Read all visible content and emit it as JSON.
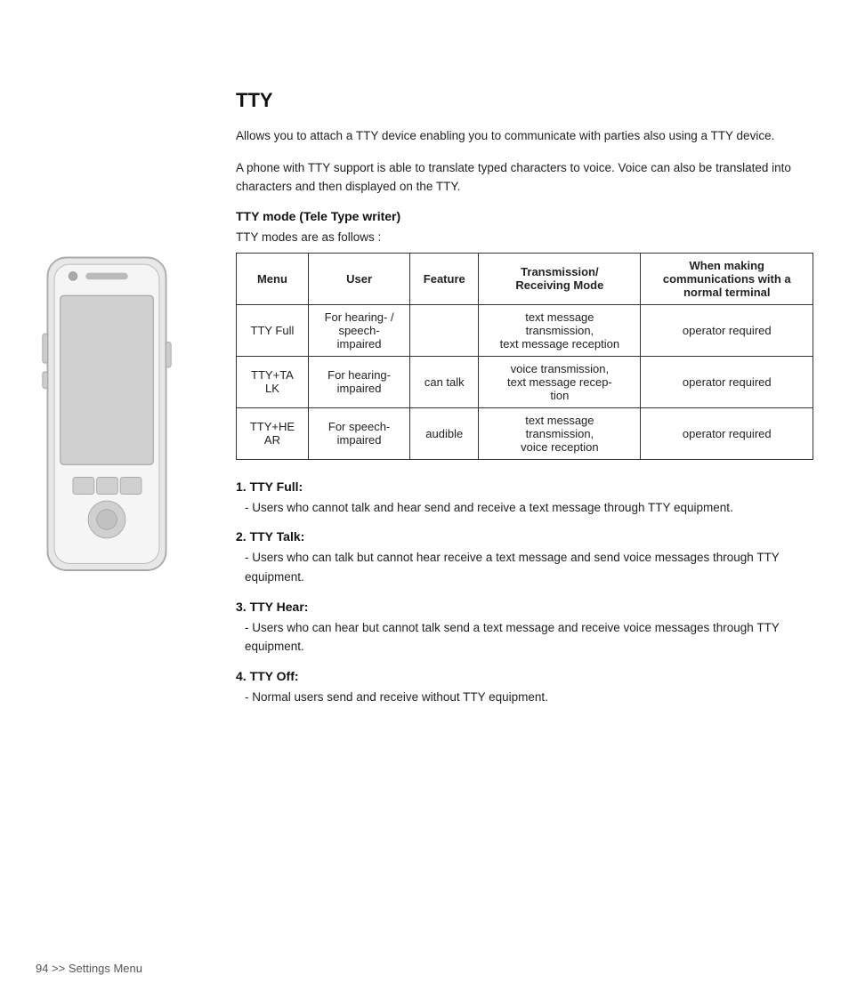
{
  "page": {
    "title": "TTY",
    "intro1": "Allows you to attach a TTY device enabling you to communicate with parties also using a TTY device.",
    "intro2": "A phone with TTY support is able to translate typed characters to voice. Voice can also be translated into characters and then displayed on the TTY.",
    "section_heading": "TTY mode (Tele Type writer)",
    "modes_intro": "TTY modes are as follows :",
    "table": {
      "headers": [
        "Menu",
        "User",
        "Feature",
        "Transmission/\nReceiving Mode",
        "When making\ncommunications with a\nnormal terminal"
      ],
      "rows": [
        {
          "menu": "TTY Full",
          "user": "For hearing- / speech-impaired",
          "feature": "",
          "transmission": "text message transmission, text message reception",
          "when": "operator required"
        },
        {
          "menu": "TTY+TALK",
          "user": "For hearing-impaired",
          "feature": "can talk",
          "transmission": "voice transmission, text message reception",
          "when": "operator required"
        },
        {
          "menu": "TTY+HEAR",
          "user": "For speech-impaired",
          "feature": "audible",
          "transmission": "text message transmission, voice reception",
          "when": "operator required"
        }
      ]
    },
    "sections": [
      {
        "heading": "1. TTY Full:",
        "text": "- Users who cannot talk and hear send and receive a text message through TTY equipment."
      },
      {
        "heading": "2. TTY Talk:",
        "text": "- Users who can talk but cannot hear receive a text message and send voice messages through TTY equipment."
      },
      {
        "heading": "3. TTY Hear:",
        "text": "- Users who can hear but cannot talk send a text message and receive voice messages through TTY equipment."
      },
      {
        "heading": "4. TTY Off:",
        "text": "- Normal users send and receive without TTY equipment."
      }
    ],
    "footer": "94 >>  Settings Menu"
  }
}
